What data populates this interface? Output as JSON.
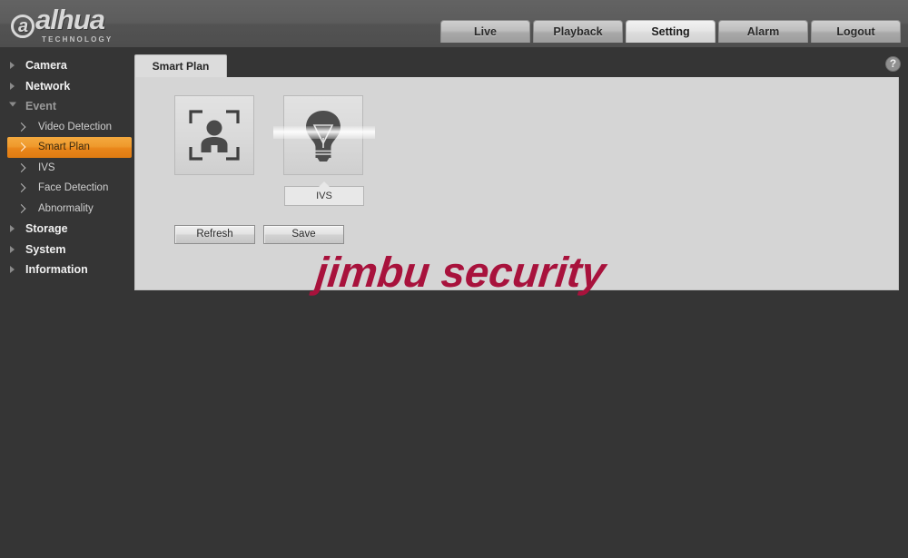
{
  "brand": {
    "name": "alhua",
    "tagline": "TECHNOLOGY"
  },
  "nav": {
    "tabs": [
      {
        "label": "Live",
        "active": false
      },
      {
        "label": "Playback",
        "active": false
      },
      {
        "label": "Setting",
        "active": true
      },
      {
        "label": "Alarm",
        "active": false
      },
      {
        "label": "Logout",
        "active": false
      }
    ]
  },
  "sidebar": {
    "items": [
      {
        "label": "Camera",
        "type": "top",
        "expanded": false
      },
      {
        "label": "Network",
        "type": "top",
        "expanded": false
      },
      {
        "label": "Event",
        "type": "top",
        "expanded": true
      },
      {
        "label": "Video Detection",
        "type": "sub",
        "selected": false
      },
      {
        "label": "Smart Plan",
        "type": "sub",
        "selected": true
      },
      {
        "label": "IVS",
        "type": "sub",
        "selected": false
      },
      {
        "label": "Face Detection",
        "type": "sub",
        "selected": false
      },
      {
        "label": "Abnormality",
        "type": "sub",
        "selected": false
      },
      {
        "label": "Storage",
        "type": "top",
        "expanded": false
      },
      {
        "label": "System",
        "type": "top",
        "expanded": false
      },
      {
        "label": "Information",
        "type": "top",
        "expanded": false
      }
    ]
  },
  "content": {
    "tab_label": "Smart Plan",
    "help_glyph": "?",
    "features": [
      {
        "icon": "face-detection-icon",
        "label": "",
        "highlighted": false
      },
      {
        "icon": "lightbulb-ivs-icon",
        "label": "IVS",
        "highlighted": true
      }
    ],
    "buttons": {
      "refresh": "Refresh",
      "save": "Save"
    }
  },
  "watermark": {
    "text": "jimbu security",
    "color": "#A8123C"
  },
  "colors": {
    "accent_orange": "#ef9a2c",
    "header_gray": "#5c5c5c",
    "background_dark": "#353535",
    "panel_gray": "#d5d5d5"
  }
}
